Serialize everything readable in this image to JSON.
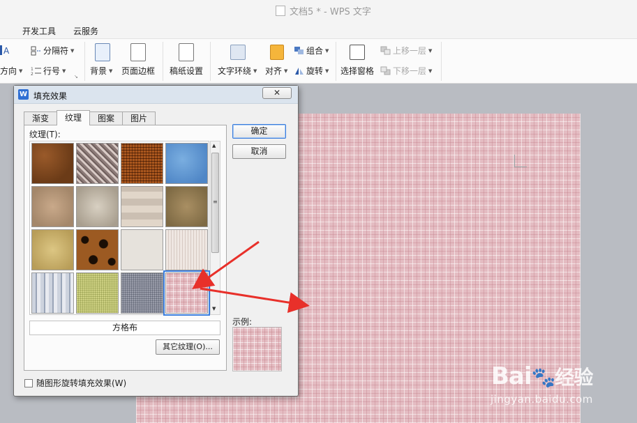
{
  "window": {
    "title": "文档5 * - WPS 文字"
  },
  "menu": {
    "tabs": [
      "开发工具",
      "云服务"
    ]
  },
  "ribbon": {
    "text_direction_partial": "方向",
    "section_break": "分隔符",
    "line_number": "行号",
    "background": "背景",
    "page_border": "页面边框",
    "manuscript": "稿纸设置",
    "text_wrap": "文字环绕",
    "align": "对齐",
    "group": "组合",
    "rotate": "旋转",
    "selection_pane": "选择窗格",
    "bring_forward": "上移一层",
    "send_backward": "下移一层"
  },
  "dialog": {
    "title": "填充效果",
    "close_glyph": "✕",
    "tabs": [
      "渐变",
      "纹理",
      "图案",
      "图片"
    ],
    "active_tab": "纹理",
    "texture_label": "纹理(T):",
    "selected_texture_name": "方格布",
    "other_texture_button": "其它纹理(O)...",
    "ok_button": "确定",
    "cancel_button": "取消",
    "preview_label": "示例:",
    "rotate_checkbox_label": "随图形旋转填充效果(W)",
    "rotate_checkbox_checked": false
  },
  "colors": {
    "selection_accent": "#3b7ddd",
    "arrow_red": "#e8302a",
    "page_fill": "#e4bcc2"
  },
  "watermark": {
    "logo_text": "Bai",
    "logo_text2": "经验",
    "url": "jingyan.baidu.com"
  }
}
